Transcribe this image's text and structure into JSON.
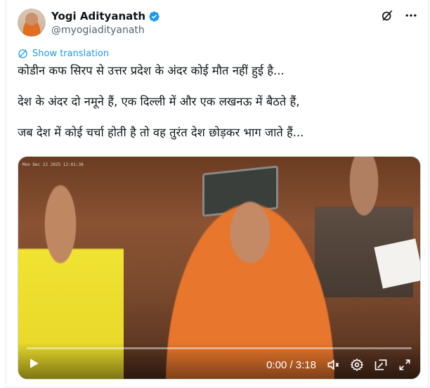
{
  "author": {
    "display_name": "Yogi Adityanath",
    "handle": "@myogiadityanath",
    "verified_color": "#1d9bf0"
  },
  "icons": {
    "grok": "grok-icon",
    "more": "more-icon",
    "globe": "globe-icon",
    "play": "play-icon",
    "volume": "volume-icon",
    "settings": "settings-icon",
    "pip": "pip-icon",
    "fullscreen": "fullscreen-icon"
  },
  "translate": {
    "label": "Show translation"
  },
  "tweet": {
    "lines": [
      "कोडीन कफ सिरप से उत्तर प्रदेश के अंदर कोई मौत नहीं हुई है...",
      "देश के अंदर दो नमूने हैं, एक दिल्ली में और एक लखनऊ में बैठते हैं,",
      "जब देश में कोई चर्चा होती है तो वह तुरंत देश छोड़कर भाग जाते हैं..."
    ]
  },
  "video": {
    "time": "0:00 / 3:18",
    "progress": 0,
    "overlay_text": "Mon Dec 22 2025 12:01:38"
  },
  "colors": {
    "accent": "#1d9bf0",
    "text": "#0f1419",
    "muted": "#536471"
  }
}
